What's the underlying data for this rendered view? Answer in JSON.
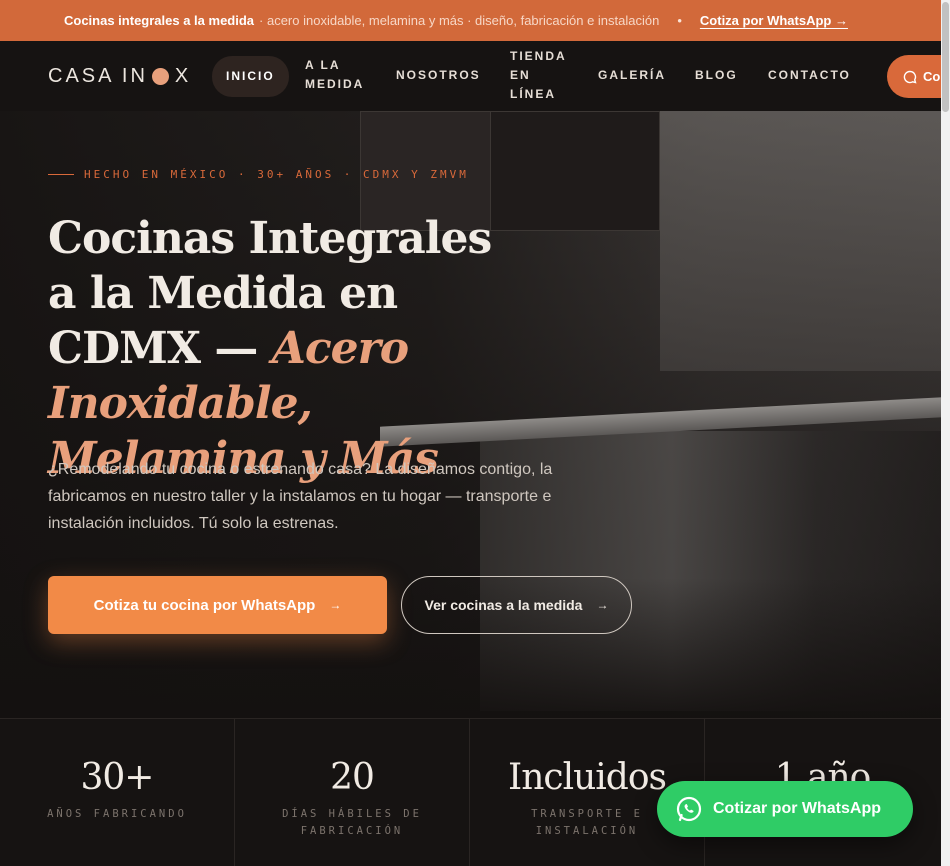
{
  "announcement": {
    "title": "Cocinas integrales a la medida",
    "details": "· acero inoxidable, melamina y más · diseño, fabricación e instalación",
    "separator": "•",
    "cta": "Cotiza por WhatsApp →"
  },
  "nav": {
    "logo_left": "CASA IN",
    "logo_right": "X",
    "items": [
      {
        "label": "INICIO"
      },
      {
        "label": "A LA MEDIDA"
      },
      {
        "label": "NOSOTROS"
      },
      {
        "label": "TIENDA EN LÍNEA"
      },
      {
        "label": "GALERÍA"
      },
      {
        "label": "BLOG"
      },
      {
        "label": "CONTACTO"
      }
    ],
    "cta_label": "Co"
  },
  "hero": {
    "eyebrow": "HECHO EN MÉXICO · 30+ AÑOS · CDMX Y ZMVM",
    "headline_plain": "Cocinas Integrales a la Medida en CDMX",
    "headline_accent_dash": "—",
    "headline_accent": "Acero Inoxidable, Melamina y Más",
    "lead": "¿Remodelando tu cocina o estrenando casa? La diseñamos contigo, la fabricamos en nuestro taller y la instalamos en tu hogar — transporte e instalación incluidos. Tú solo la estrenas.",
    "primary_cta": "Cotiza tu cocina por WhatsApp",
    "secondary_cta": "Ver cocinas a la medida",
    "arrow": "→"
  },
  "stats": [
    {
      "value": "30+",
      "label": "AÑOS FABRICANDO"
    },
    {
      "value": "20",
      "label": "DÍAS HÁBILES DE FABRICACIÓN"
    },
    {
      "value": "Incluidos",
      "label": "TRANSPORTE E INSTALACIÓN"
    },
    {
      "value": "1 año",
      "label": ""
    }
  ],
  "whatsapp_float": {
    "label": "Cotizar por WhatsApp",
    "icon": "whatsapp-icon"
  },
  "colors": {
    "accent": "#d9693a",
    "accent_light": "#e8a07c",
    "primary_button": "#f28a47",
    "whatsapp": "#2fcc66",
    "background": "#141110"
  }
}
